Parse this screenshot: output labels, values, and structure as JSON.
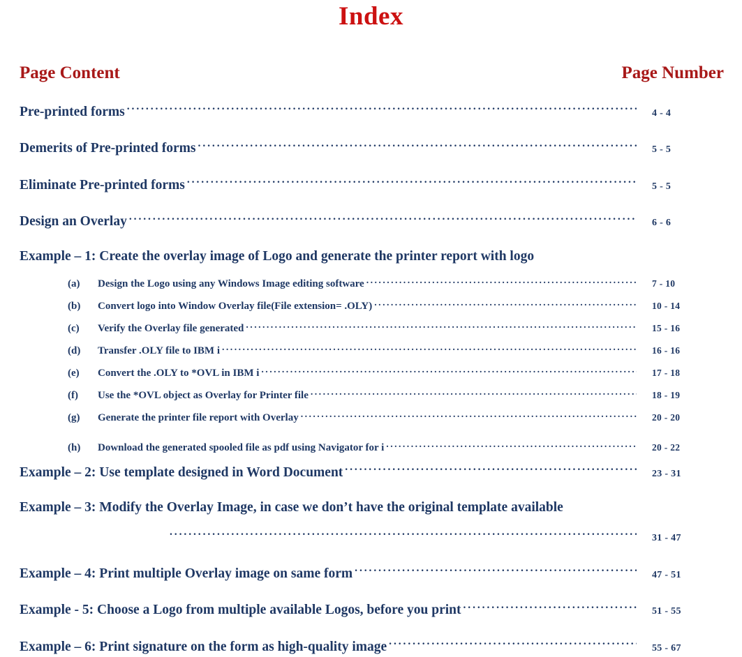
{
  "document": {
    "title": "Index",
    "colors": {
      "title_red": "#CC1111",
      "header_red": "#A81818",
      "body_navy": "#1F3864",
      "background": "#FFFFFF"
    }
  },
  "headers": {
    "left": "Page Content",
    "right": "Page Number"
  },
  "entries": [
    {
      "level": "main",
      "label": "Pre-printed forms",
      "page": "4 - 4"
    },
    {
      "level": "main",
      "label": "Demerits of Pre-printed forms",
      "page": "5 - 5"
    },
    {
      "level": "main",
      "label": "Eliminate Pre-printed forms",
      "page": "5 - 5"
    },
    {
      "level": "main",
      "label": "Design an Overlay",
      "page": "6 - 6"
    },
    {
      "level": "main",
      "heading_only": true,
      "label": "Example – 1: Create the overlay image of Logo and generate the printer report with logo",
      "page": ""
    },
    {
      "level": "sub",
      "marker": "(a)",
      "label": "Design the Logo using any Windows Image editing software",
      "page": "7 - 10"
    },
    {
      "level": "sub",
      "marker": "(b)",
      "label": "Convert logo into Window Overlay file(File extension= .OLY)",
      "page": "10 - 14"
    },
    {
      "level": "sub",
      "marker": "(c)",
      "label": "Verify the Overlay file generated",
      "page": "15 - 16"
    },
    {
      "level": "sub",
      "marker": "(d)",
      "label": "Transfer .OLY file to IBM i",
      "page": "16 - 16"
    },
    {
      "level": "sub",
      "marker": "(e)",
      "label": "Convert the .OLY to *OVL in IBM i",
      "page": "17 - 18"
    },
    {
      "level": "sub",
      "marker": "(f)",
      "label": "Use the *OVL object as Overlay for Printer file",
      "page": "18 - 19"
    },
    {
      "level": "sub",
      "marker": "(g)",
      "label": "Generate the printer file report with Overlay",
      "page": "20 - 20"
    },
    {
      "level": "sub",
      "gap_above": true,
      "marker": "(h)",
      "label": "Download the generated spooled file as pdf using Navigator for i",
      "page": "20 - 22"
    },
    {
      "level": "main",
      "label": "Example – 2:  Use template designed in Word Document",
      "page": "23 - 31"
    },
    {
      "level": "main",
      "heading_only": true,
      "label": "Example – 3:  Modify the Overlay Image, in case we don’t have the original template available",
      "page": ""
    },
    {
      "level": "continuation",
      "label": "",
      "page": "31 - 47"
    },
    {
      "level": "main",
      "label": "Example – 4:  Print multiple Overlay image on same form",
      "page": "47 - 51"
    },
    {
      "level": "main",
      "label": "Example - 5:  Choose a Logo from multiple available Logos, before you print",
      "page": "51 - 55"
    },
    {
      "level": "main",
      "label": "Example – 6:  Print signature on the form as high-quality image",
      "page": "55 - 67"
    }
  ]
}
